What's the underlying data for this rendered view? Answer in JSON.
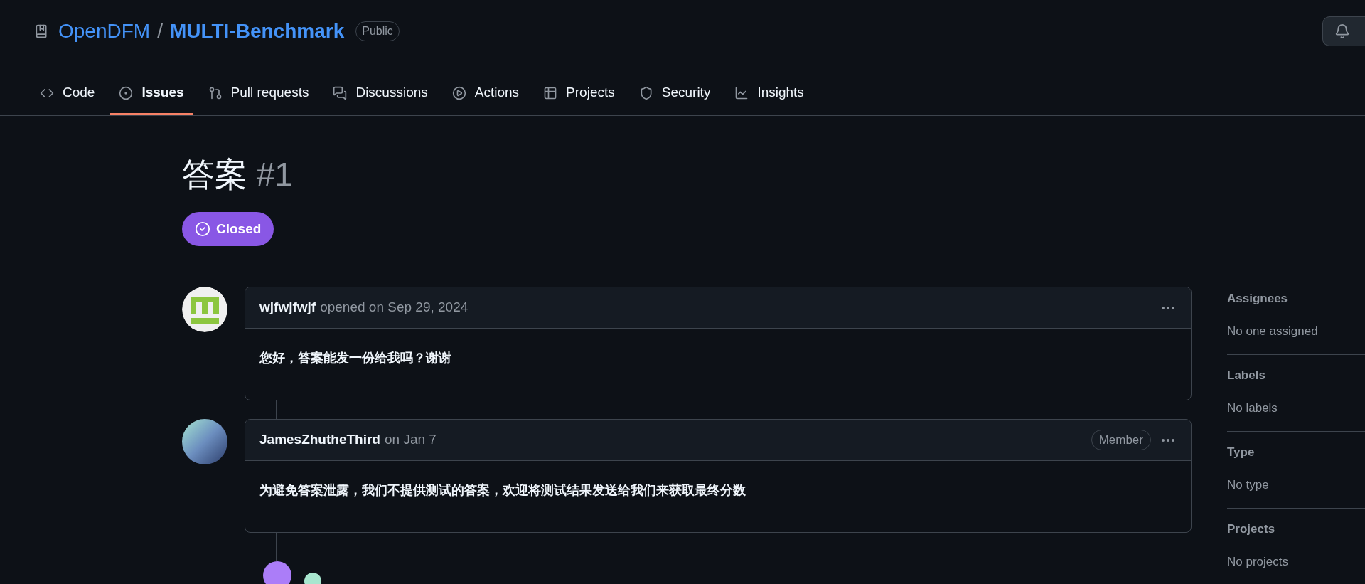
{
  "repo": {
    "owner": "OpenDFM",
    "separator": "/",
    "name": "MULTI-Benchmark",
    "visibility": "Public"
  },
  "tabs": [
    {
      "label": "Code",
      "selected": false
    },
    {
      "label": "Issues",
      "selected": true
    },
    {
      "label": "Pull requests",
      "selected": false
    },
    {
      "label": "Discussions",
      "selected": false
    },
    {
      "label": "Actions",
      "selected": false
    },
    {
      "label": "Projects",
      "selected": false
    },
    {
      "label": "Security",
      "selected": false
    },
    {
      "label": "Insights",
      "selected": false
    }
  ],
  "issue": {
    "title": "答案",
    "number": "#1",
    "status": {
      "label": "Closed",
      "kind": "closed"
    }
  },
  "comments": [
    {
      "author": "wjfwjfwjf",
      "meta": "opened on Sep 29, 2024",
      "body": "您好，答案能发一份给我吗？谢谢"
    },
    {
      "author": "JamesZhutheThird",
      "meta": "on Jan 7",
      "badge": "Member",
      "body": "为避免答案泄露，我们不提供测试的答案，欢迎将测试结果发送给我们来获取最终分数"
    }
  ],
  "sidebar": [
    {
      "heading": "Assignees",
      "value": "No one assigned"
    },
    {
      "heading": "Labels",
      "value": "No labels"
    },
    {
      "heading": "Type",
      "value": "No type"
    },
    {
      "heading": "Projects",
      "value": "No projects"
    }
  ]
}
